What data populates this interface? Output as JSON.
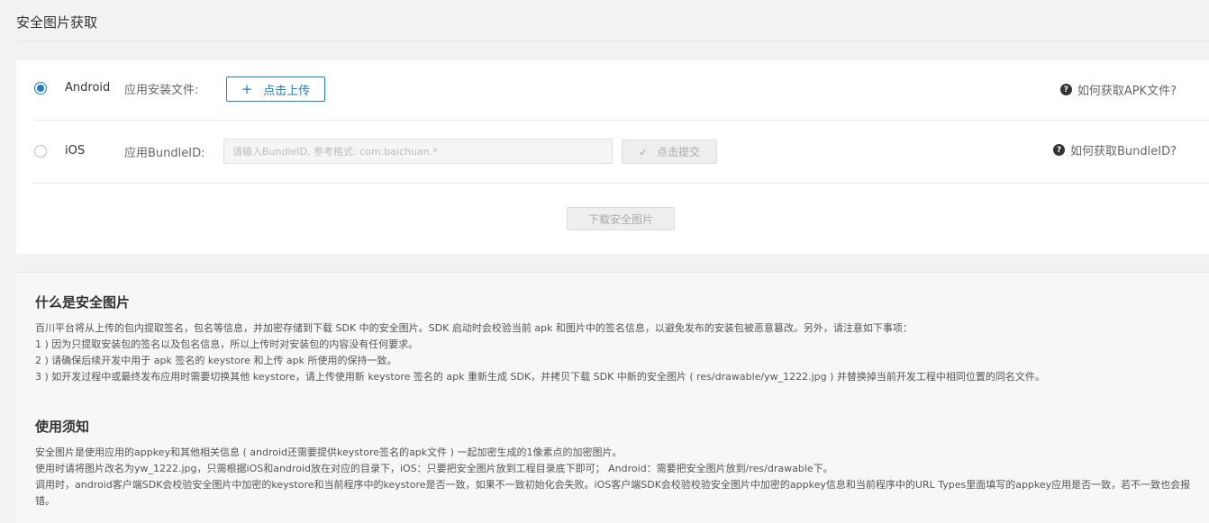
{
  "page": {
    "title": "安全图片获取"
  },
  "android": {
    "label": "Android",
    "field_label": "应用安装文件:",
    "upload_button": "点击上传",
    "upload_icon": "+",
    "help_text": "如何获取APK文件?"
  },
  "ios": {
    "label": "iOS",
    "field_label": "应用BundleID:",
    "input_placeholder": "请输入BundleID, 参考格式: com.baichuan.*",
    "input_value": "",
    "submit_button": "点击提交",
    "submit_icon": "✓",
    "help_text": "如何获取BundleID?"
  },
  "download_button": "下载安全图片",
  "help_icon": "?",
  "info": {
    "what_title": "什么是安全图片",
    "what_lines": [
      "百川平台将从上传的包内提取签名，包名等信息，并加密存储到下载 SDK 中的安全图片。SDK 启动时会校验当前 apk 和图片中的签名信息，以避免发布的安装包被恶意篡改。另外，请注意如下事项：",
      "1 ) 因为只提取安装包的签名以及包名信息，所以上传时对安装包的内容没有任何要求。",
      "2 ) 请确保后续开发中用于 apk 签名的 keystore 和上传 apk 所使用的保持一致。",
      "3 ) 如开发过程中或最终发布应用时需要切换其他 keystore，请上传使用新 keystore 签名的 apk 重新生成 SDK，并拷贝下载 SDK 中新的安全图片 ( res/drawable/yw_1222.jpg ) 并替换掉当前开发工程中相同位置的同名文件。"
    ],
    "usage_title": "使用须知",
    "usage_lines": [
      "安全图片是使用应用的appkey和其他相关信息 ( android还需要提供keystore签名的apk文件 ) 一起加密生成的1像素点的加密图片。",
      "使用时请将图片改名为yw_1222.jpg，只需根据iOS和android放在对应的目录下，iOS：只要把安全图片放到工程目录底下即可； Android：需要把安全图片放到/res/drawable下。",
      "调用时，android客户端SDK会校验安全图片中加密的keystore和当前程序中的keystore是否一致，如果不一致初始化会失败。iOS客户端SDK会校验校验安全图片中加密的appkey信息和当前程序中的URL Types里面填写的appkey应用是否一致，若不一致也会报错。"
    ]
  },
  "colors": {
    "accent": "#1e7ec8",
    "background": "#f2f2f2",
    "card": "#ffffff"
  }
}
